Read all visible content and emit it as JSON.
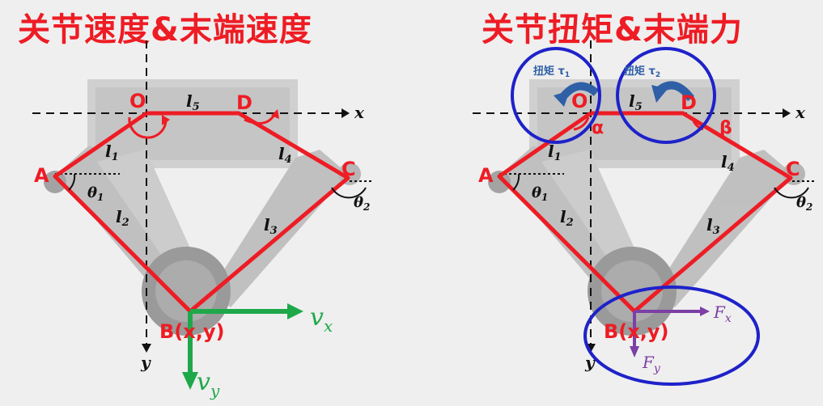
{
  "left": {
    "title": "关节速度&末端速度",
    "point_O": "O",
    "point_D": "D",
    "point_A": "A",
    "point_C": "C",
    "point_B": "B(x,y)",
    "axis_x": "x",
    "axis_y": "y",
    "link_l1": "l",
    "link_l1_sub": "1",
    "link_l2": "l",
    "link_l2_sub": "2",
    "link_l3": "l",
    "link_l3_sub": "3",
    "link_l4": "l",
    "link_l4_sub": "4",
    "link_l5": "l",
    "link_l5_sub": "5",
    "theta1": "θ",
    "theta1_sub": "1",
    "theta2": "θ",
    "theta2_sub": "2",
    "vx": "v",
    "vx_sub": "x",
    "vy": "v",
    "vy_sub": "y"
  },
  "right": {
    "title": "关节扭矩&末端力",
    "point_O": "O",
    "point_D": "D",
    "point_A": "A",
    "point_C": "C",
    "point_B": "B(x,y)",
    "axis_x": "x",
    "axis_y": "y",
    "link_l1": "l",
    "link_l1_sub": "1",
    "link_l2": "l",
    "link_l2_sub": "2",
    "link_l3": "l",
    "link_l3_sub": "3",
    "link_l4": "l",
    "link_l4_sub": "4",
    "link_l5": "l",
    "link_l5_sub": "5",
    "theta1": "θ",
    "theta1_sub": "1",
    "theta2": "θ",
    "theta2_sub": "2",
    "alpha": "α",
    "beta": "β",
    "torque1": "扭矩 τ",
    "torque1_sub": "1",
    "torque2": "扭矩 τ",
    "torque2_sub": "2",
    "fx": "F",
    "fx_sub": "x",
    "fy": "F",
    "fy_sub": "y"
  },
  "colors": {
    "linkage": "#ee1c24",
    "velocity": "#1fa84a",
    "force": "#7b3fa6",
    "highlight_circle": "#1e22c9",
    "torque_arrow": "#2f5fa6"
  }
}
